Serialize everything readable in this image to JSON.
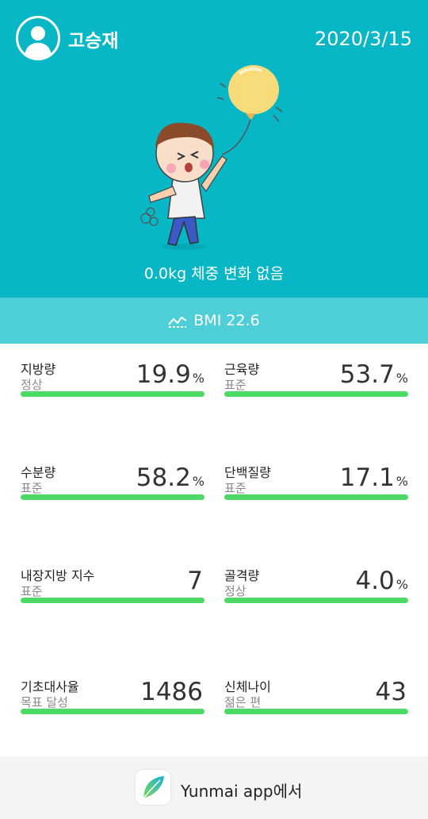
{
  "header": {
    "username": "고승재",
    "date": "2020/3/15",
    "weight_status": "0.0kg 체중 변화 없음"
  },
  "bmi": {
    "label": "BMI 22.6"
  },
  "metrics": [
    {
      "name": "지방량",
      "status": "정상",
      "value": "19.9",
      "unit": "%"
    },
    {
      "name": "근육량",
      "status": "표준",
      "value": "53.7",
      "unit": "%"
    },
    {
      "name": "수분량",
      "status": "표준",
      "value": "58.2",
      "unit": "%"
    },
    {
      "name": "단백질량",
      "status": "표준",
      "value": "17.1",
      "unit": "%"
    },
    {
      "name": "내장지방 지수",
      "status": "표준",
      "value": "7",
      "unit": ""
    },
    {
      "name": "골격량",
      "status": "정상",
      "value": "4.0",
      "unit": "%"
    },
    {
      "name": "기초대사율",
      "status": "목표 달성",
      "value": "1486",
      "unit": ""
    },
    {
      "name": "신체나이",
      "status": "젊은 편",
      "value": "43",
      "unit": ""
    }
  ],
  "footer": {
    "app_text": "Yunmai app에서"
  },
  "colors": {
    "header_bg": "#07b7c5",
    "bmi_bg": "#4ecfd7",
    "progress_green": "#4cd964"
  },
  "icons": {
    "avatar": "user-silhouette-icon",
    "bmi": "trend-icon",
    "app": "yunmai-feather-icon"
  }
}
